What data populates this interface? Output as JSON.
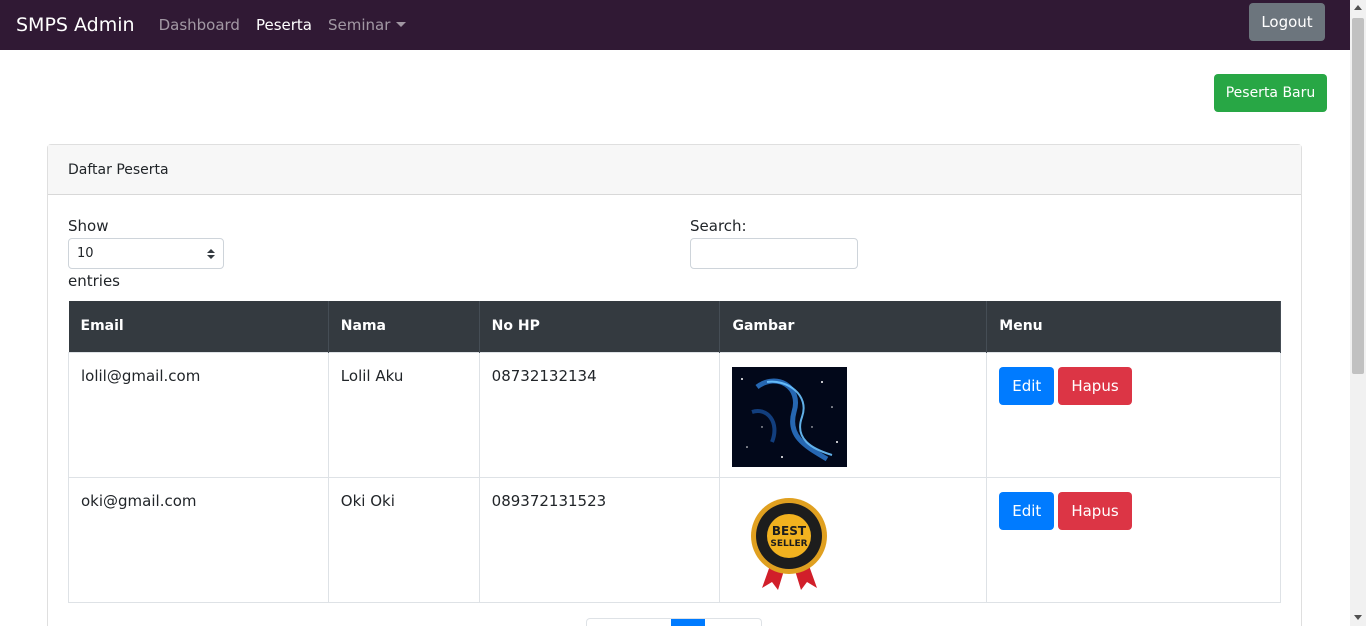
{
  "navbar": {
    "brand": "SMPS Admin",
    "links": [
      "Dashboard",
      "Peserta",
      "Seminar"
    ],
    "logout": "Logout"
  },
  "actions": {
    "new_button": "Peserta Baru"
  },
  "card": {
    "header": "Daftar Peserta"
  },
  "controls": {
    "show_label": "Show",
    "show_value": "10",
    "entries_label": "entries",
    "search_label": "Search:",
    "search_value": ""
  },
  "table": {
    "headers": [
      "Email",
      "Nama",
      "No HP",
      "Gambar",
      "Menu"
    ],
    "rows": [
      {
        "email": "lolil@gmail.com",
        "nama": "Lolil Aku",
        "hp": "08732132134",
        "image": "nebula-photo",
        "edit": "Edit",
        "delete": "Hapus"
      },
      {
        "email": "oki@gmail.com",
        "nama": "Oki Oki",
        "hp": "089372131523",
        "image": "best-seller-badge",
        "badge_line1": "BEST",
        "badge_line2": "SELLER",
        "edit": "Edit",
        "delete": "Hapus"
      }
    ]
  },
  "colors": {
    "navbar": "#301934",
    "success": "#28a745",
    "primary": "#007bff",
    "danger": "#dc3545",
    "table_head": "#343a40"
  }
}
